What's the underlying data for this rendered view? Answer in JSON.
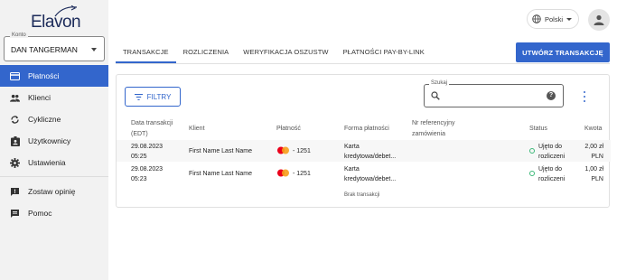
{
  "brand": {
    "logo_text": "Elavon"
  },
  "account": {
    "label": "Konto",
    "value": "DAN TANGERMAN"
  },
  "sidebar": {
    "items": [
      {
        "label": "Płatności",
        "icon": "credit-card-icon",
        "active": true
      },
      {
        "label": "Klienci",
        "icon": "people-icon",
        "active": false
      },
      {
        "label": "Cykliczne",
        "icon": "sync-icon",
        "active": false
      },
      {
        "label": "Użytkownicy",
        "icon": "badge-icon",
        "active": false
      },
      {
        "label": "Ustawienia",
        "icon": "gear-icon",
        "active": false
      }
    ],
    "secondary": [
      {
        "label": "Zostaw opinię",
        "icon": "feedback-icon"
      },
      {
        "label": "Pomoc",
        "icon": "help-chat-icon"
      }
    ]
  },
  "header": {
    "language": "Polski"
  },
  "tabs": [
    {
      "label": "TRANSAKCJE",
      "active": true
    },
    {
      "label": "ROZLICZENIA",
      "active": false
    },
    {
      "label": "WERYFIKACJA OSZUSTW",
      "active": false
    },
    {
      "label": "PŁATNOŚCI PAY-BY-LINK",
      "active": false
    }
  ],
  "actions": {
    "create_label": "UTWÓRZ TRANSAKCJĘ",
    "filter_label": "FILTRY"
  },
  "search": {
    "label": "Szukaj",
    "placeholder": "",
    "value": ""
  },
  "table": {
    "headers": {
      "date_line1": "Data transakcji",
      "date_line2": "(EDT)",
      "client": "Klient",
      "payment": "Płatność",
      "form_line1": "Forma płatności",
      "ref_line1": "Nr referencyjny",
      "ref_line2": "zamówienia",
      "status": "Status",
      "amount": "Kwota"
    },
    "rows": [
      {
        "date": "29.08.2023",
        "time": "05:25",
        "client": "First Name Last Name",
        "card_suffix": "- 1251",
        "form_line1": "Karta",
        "form_line2": "kredytowa/debet...",
        "ref": "",
        "status_line1": "Ujęto do",
        "status_line2": "rozliczeni",
        "amount_line1": "2,00 zł",
        "amount_line2": "PLN"
      },
      {
        "date": "29.08.2023",
        "time": "05:23",
        "client": "First Name Last Name",
        "card_suffix": "- 1251",
        "form_line1": "Karta",
        "form_line2": "kredytowa/debet...",
        "ref": "",
        "status_line1": "Ujęto do",
        "status_line2": "rozliczeni",
        "amount_line1": "1,00 zł",
        "amount_line2": "PLN"
      }
    ],
    "empty_note": "Brak transakcji"
  },
  "colors": {
    "accent": "#3366cc",
    "status_ok": "#3cb878",
    "mastercard_red": "#eb001b",
    "mastercard_orange": "#f79e1b"
  }
}
